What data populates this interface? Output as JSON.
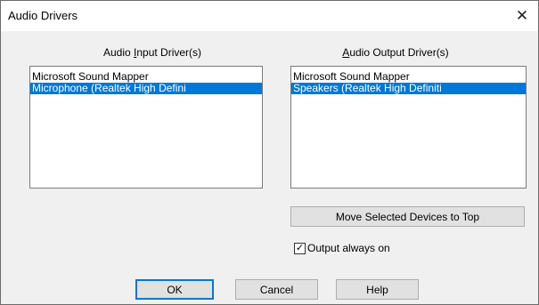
{
  "window": {
    "title": "Audio Drivers",
    "close_glyph": "✕"
  },
  "input_group": {
    "label_prefix": "Audio ",
    "label_mnemonic": "I",
    "label_suffix": "nput Driver(s)",
    "items": [
      {
        "label": "Microsoft Sound Mapper",
        "selected": false
      },
      {
        "label": "Microphone (Realtek High Defini",
        "selected": true
      }
    ]
  },
  "output_group": {
    "label_prefix": "",
    "label_mnemonic": "A",
    "label_suffix": "udio Output Driver(s)",
    "items": [
      {
        "label": "Microsoft Sound Mapper",
        "selected": false
      },
      {
        "label": "Speakers (Realtek High Definiti",
        "selected": true
      }
    ]
  },
  "move_button": {
    "label": "Move Selected Devices to Top"
  },
  "output_always_on": {
    "label": "Output always on",
    "checked": true,
    "check_glyph": "✓"
  },
  "buttons": {
    "ok": "OK",
    "cancel": "Cancel",
    "help": "Help"
  },
  "colors": {
    "selection": "#0078d7",
    "dialog_bg": "#f0f0f0"
  }
}
